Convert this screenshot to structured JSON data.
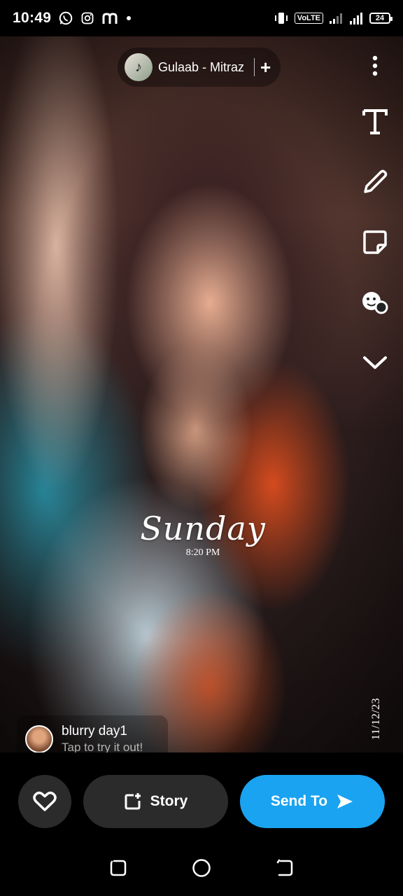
{
  "status_bar": {
    "time": "10:49",
    "left_icons": [
      "whatsapp-icon",
      "instagram-icon",
      "m-app-icon",
      "dot-icon"
    ],
    "volte": "VoLTE",
    "battery": "24"
  },
  "music": {
    "title": "Gulaab - Mitraz",
    "add_label": "+"
  },
  "toolbar": {
    "items": [
      "more-icon",
      "text-icon",
      "pencil-icon",
      "sticker-icon",
      "lens-icon",
      "chevron-down-icon"
    ]
  },
  "overlay": {
    "day": "Sunday",
    "time": "8:20 PM",
    "date": "11/12/23"
  },
  "lens": {
    "name": "blurry day1",
    "subtitle": "Tap to try it out!"
  },
  "actions": {
    "story_label": "Story",
    "send_label": "Send To",
    "send_color": "#1aa3f0",
    "button_bg": "#2b2b2b"
  }
}
